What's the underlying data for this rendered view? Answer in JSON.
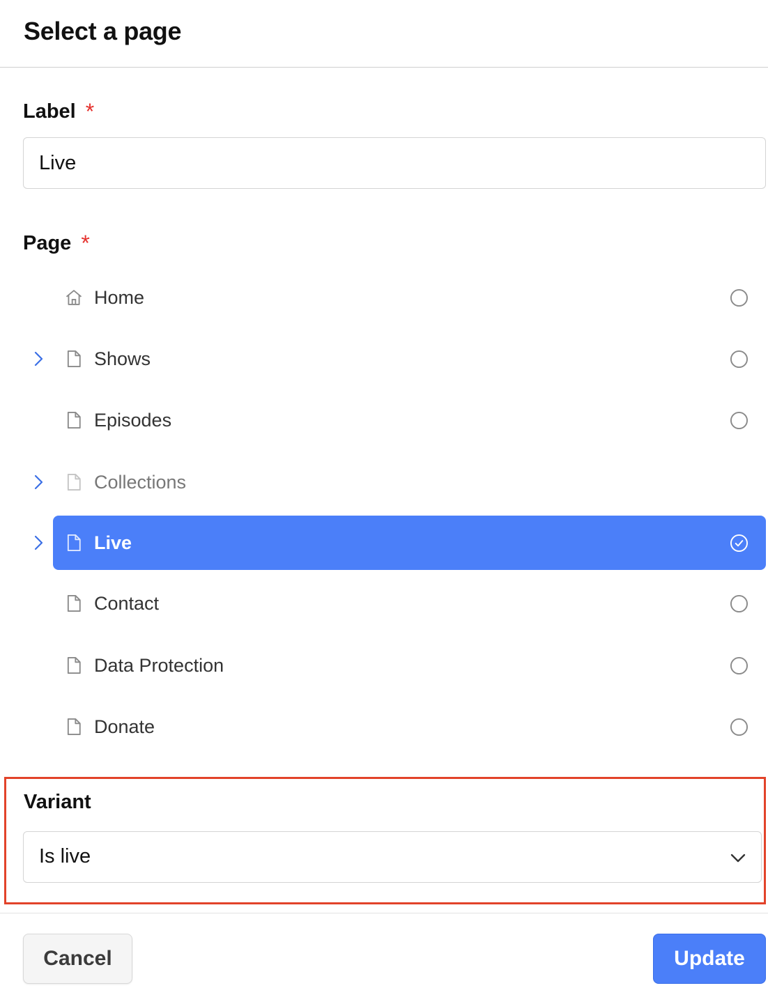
{
  "dialog": {
    "title": "Select a page"
  },
  "label_field": {
    "label": "Label",
    "required_mark": "*",
    "value": "Live"
  },
  "page_field": {
    "label": "Page",
    "required_mark": "*",
    "items": [
      {
        "label": "Home",
        "icon": "home-icon",
        "expandable": false,
        "selected": false,
        "dimmed": false
      },
      {
        "label": "Shows",
        "icon": "page-icon",
        "expandable": true,
        "selected": false,
        "dimmed": false
      },
      {
        "label": "Episodes",
        "icon": "page-icon",
        "expandable": false,
        "selected": false,
        "dimmed": false
      },
      {
        "label": "Collections",
        "icon": "page-icon",
        "expandable": true,
        "selected": false,
        "dimmed": true
      },
      {
        "label": "Live",
        "icon": "page-icon",
        "expandable": true,
        "selected": true,
        "dimmed": false
      },
      {
        "label": "Contact",
        "icon": "page-icon",
        "expandable": false,
        "selected": false,
        "dimmed": false
      },
      {
        "label": "Data Protection",
        "icon": "page-icon",
        "expandable": false,
        "selected": false,
        "dimmed": false
      },
      {
        "label": "Donate",
        "icon": "page-icon",
        "expandable": false,
        "selected": false,
        "dimmed": false
      }
    ]
  },
  "variant_field": {
    "label": "Variant",
    "value": "Is live"
  },
  "footer": {
    "cancel_label": "Cancel",
    "update_label": "Update"
  },
  "colors": {
    "accent": "#4b7ff9",
    "required": "#e5322e",
    "highlight_border": "#e2432a"
  }
}
